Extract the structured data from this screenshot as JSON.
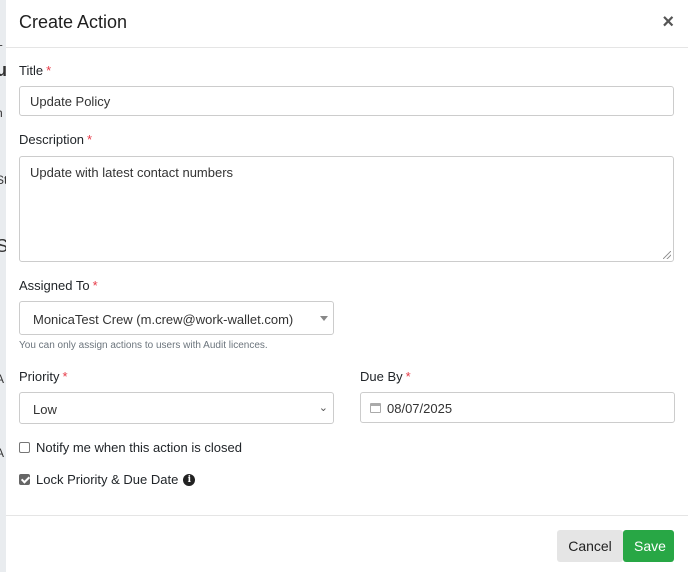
{
  "modal": {
    "title": "Create Action",
    "close_glyph": "×"
  },
  "background": {
    "fragments": [
      "L",
      "u",
      "h",
      "St",
      "S",
      "A",
      "A"
    ]
  },
  "fields": {
    "title": {
      "label": "Title",
      "value": "Update Policy"
    },
    "description": {
      "label": "Description",
      "value": "Update with latest contact numbers"
    },
    "assigned_to": {
      "label": "Assigned To",
      "value": "MonicaTest Crew (m.crew@work-wallet.com)",
      "help": "You can only assign actions to users with Audit licences."
    },
    "priority": {
      "label": "Priority",
      "value": "Low"
    },
    "due_by": {
      "label": "Due By",
      "value": "08/07/2025"
    },
    "required_marker": "*"
  },
  "options": {
    "notify": {
      "label": "Notify me when this action is closed",
      "checked": false
    },
    "lock": {
      "label": "Lock Priority & Due Date",
      "checked": true
    }
  },
  "footer": {
    "cancel_label": "Cancel",
    "save_label": "Save"
  },
  "colors": {
    "required": "#e63946",
    "save": "#28a745",
    "cancel": "#e5e5e5"
  }
}
